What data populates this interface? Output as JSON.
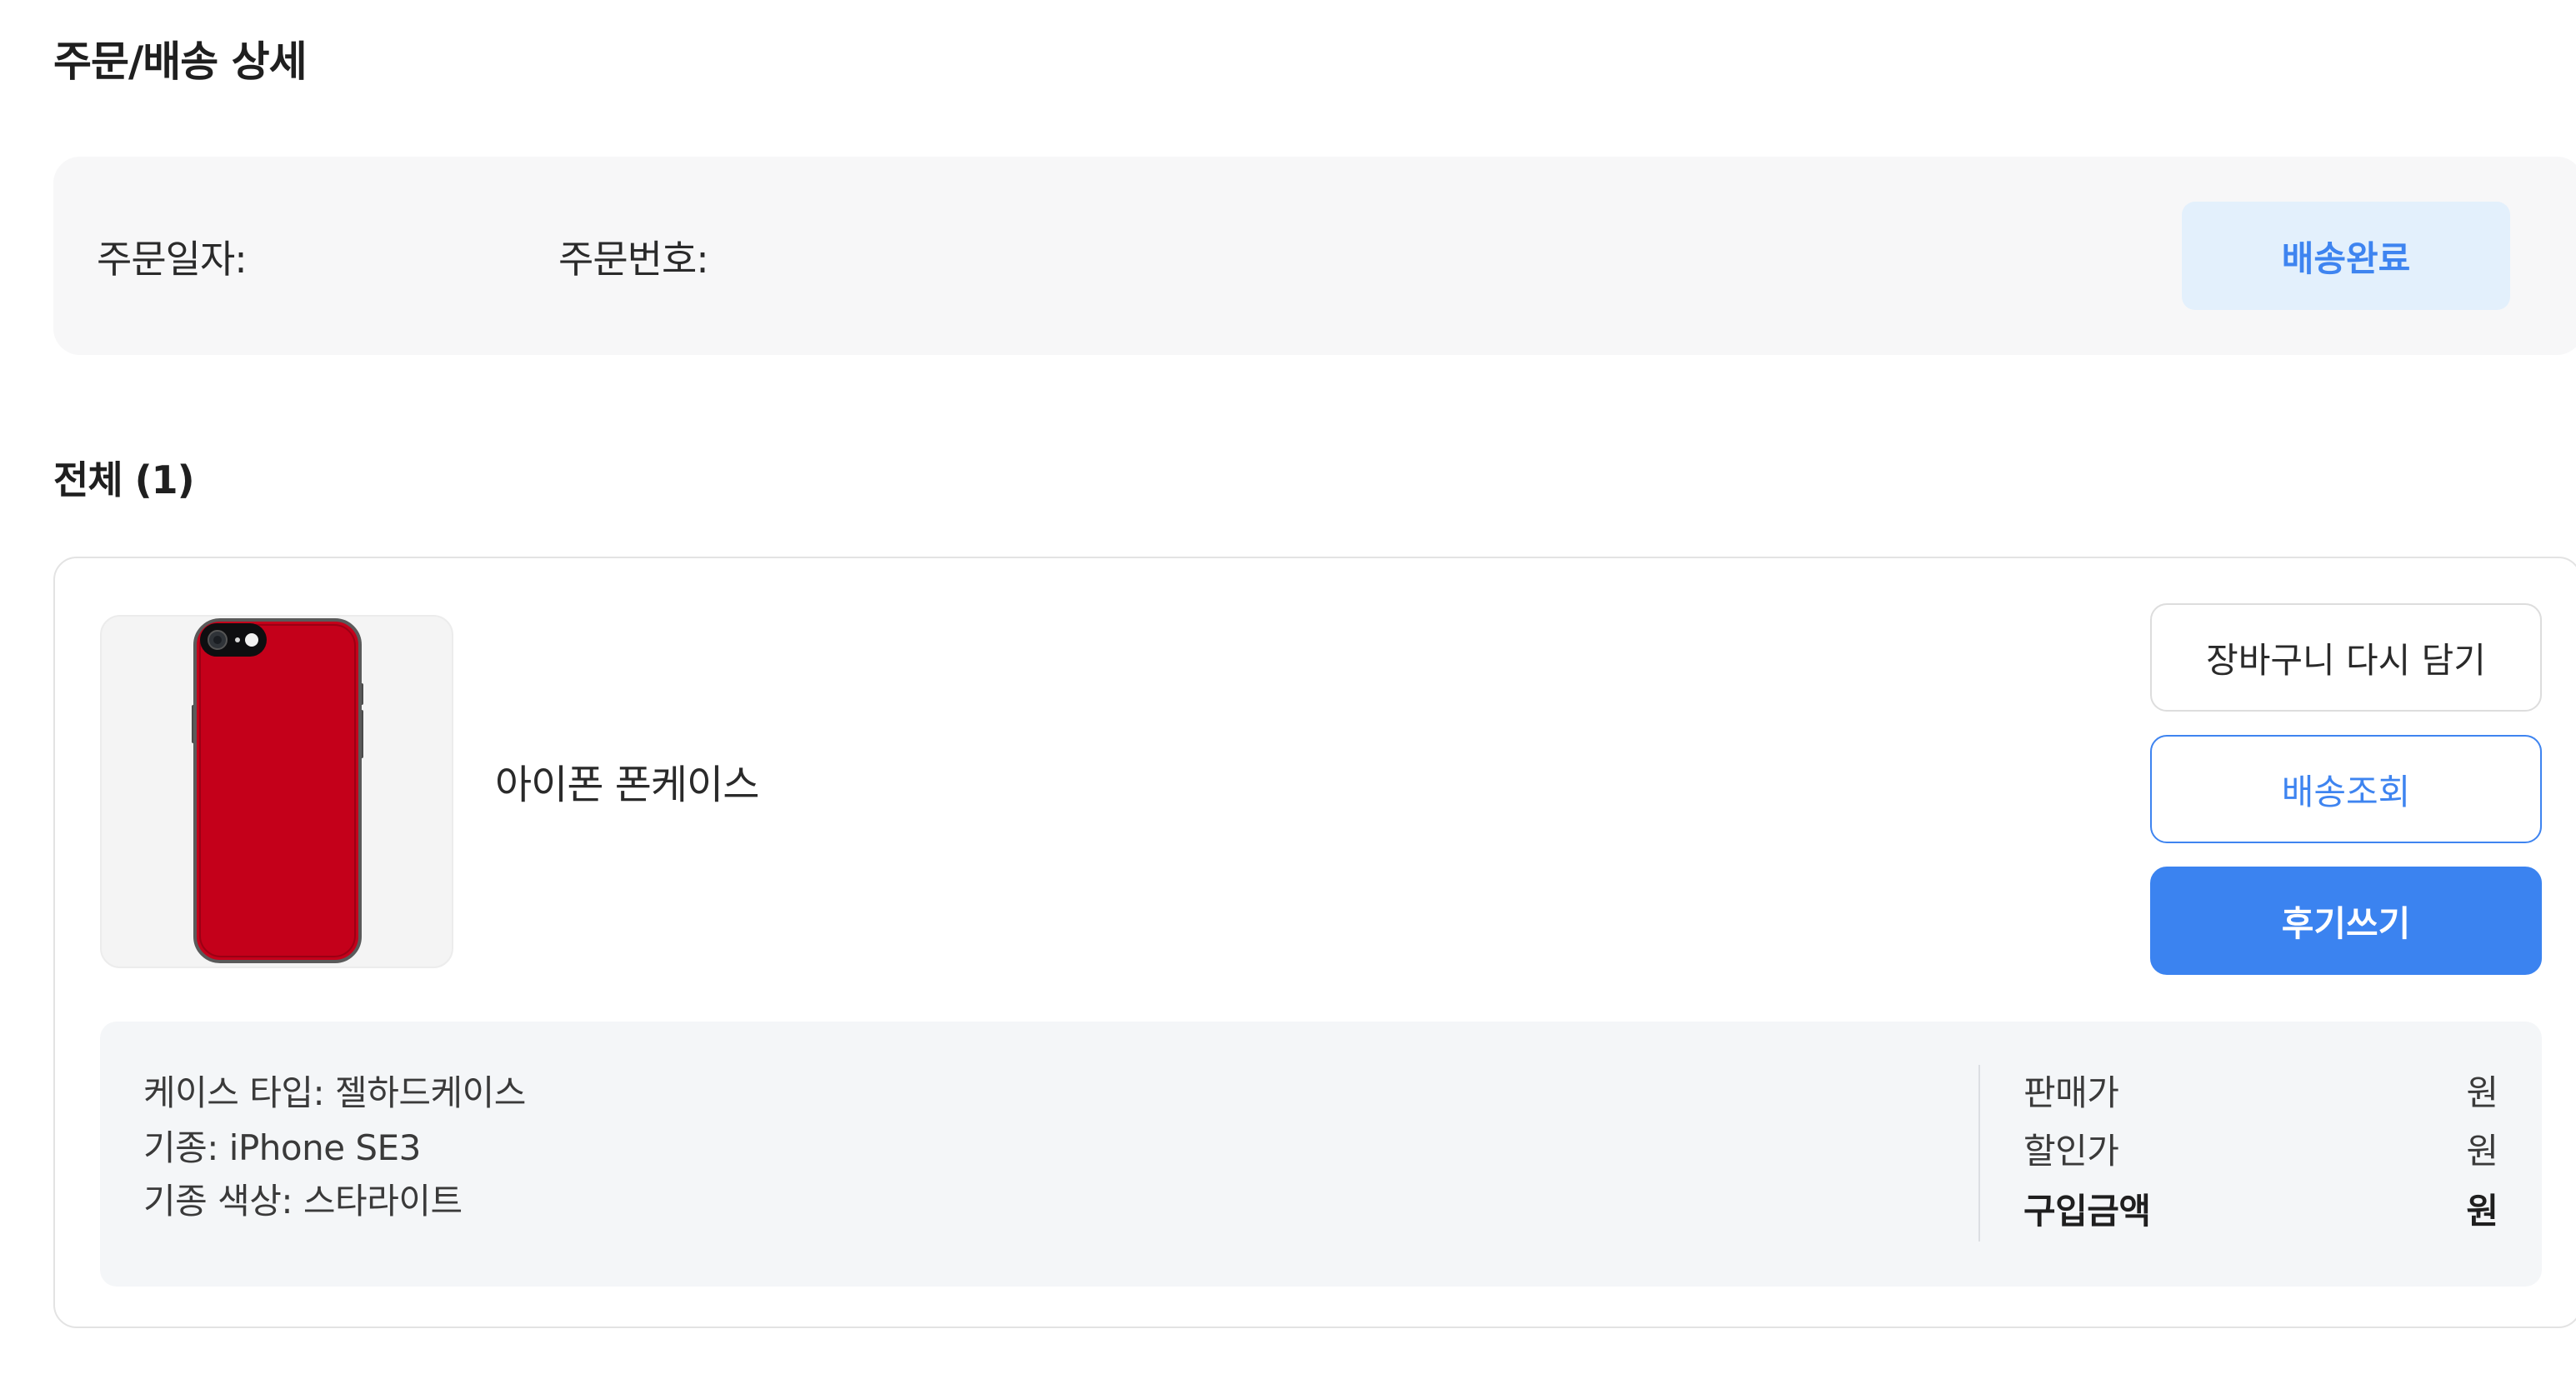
{
  "page": {
    "title": "주문/배송 상세"
  },
  "order": {
    "date_label": "주문일자:",
    "number_label": "주문번호:",
    "status": "배송완료"
  },
  "section": {
    "title": "전체 (1)"
  },
  "product": {
    "name": "아이폰 폰케이스",
    "image_icon": "iphone-case-red-icon",
    "buttons": {
      "add_to_cart": "장바구니 다시 담기",
      "track_delivery": "배송조회",
      "write_review": "후기쓰기"
    },
    "options": [
      "케이스 타입: 젤하드케이스",
      "기종: iPhone SE3",
      "기종 색상: 스타라이트"
    ],
    "prices": {
      "sale_label": "판매가",
      "sale_unit": "원",
      "discount_label": "할인가",
      "discount_unit": "원",
      "total_label": "구입금액",
      "total_unit": "원"
    }
  },
  "colors": {
    "accent": "#3b83f0",
    "status_bg": "#e3f0fc",
    "case_red": "#c4001a",
    "panel_bg": "#f4f6f8"
  }
}
